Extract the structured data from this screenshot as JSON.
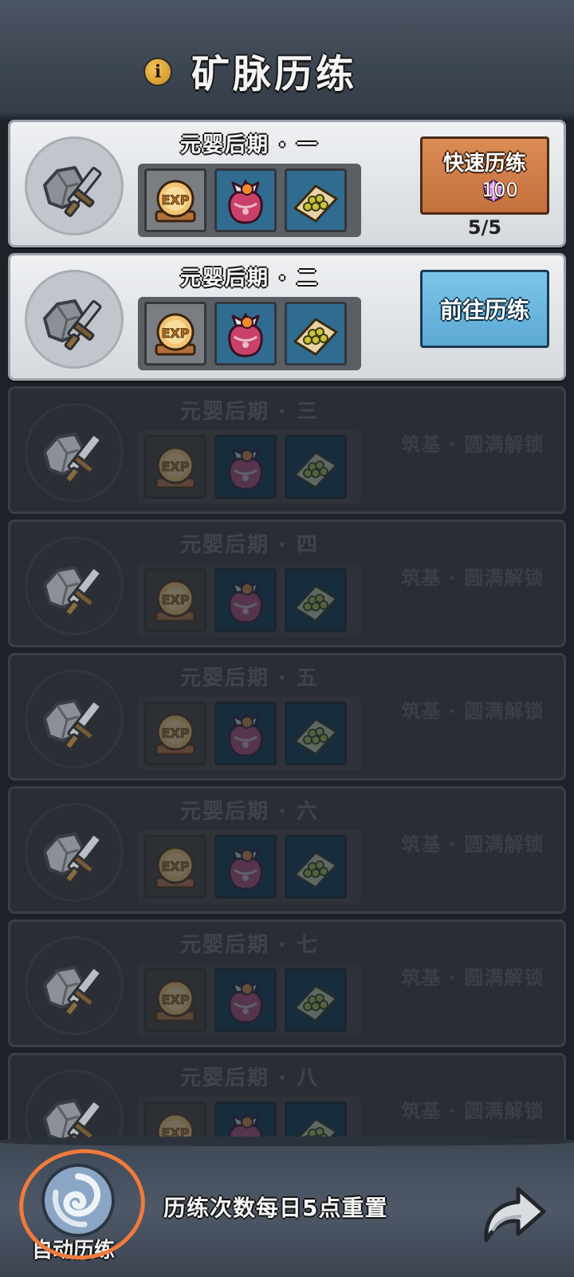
{
  "header": {
    "title": "矿脉历练",
    "info_icon": "info-icon"
  },
  "rows": [
    {
      "title": "元婴后期 · 一",
      "state": "quick",
      "button_label": "快速历练",
      "cost": "100",
      "count": "5/5"
    },
    {
      "title": "元婴后期 · 二",
      "state": "go",
      "button_label": "前往历练"
    },
    {
      "title": "元婴后期 · 三",
      "state": "locked",
      "lock_text": "筑基 · 圆满解锁"
    },
    {
      "title": "元婴后期 · 四",
      "state": "locked",
      "lock_text": "筑基 · 圆满解锁"
    },
    {
      "title": "元婴后期 · 五",
      "state": "locked",
      "lock_text": "筑基 · 圆满解锁"
    },
    {
      "title": "元婴后期 · 六",
      "state": "locked",
      "lock_text": "筑基 · 圆满解锁"
    },
    {
      "title": "元婴后期 · 七",
      "state": "locked",
      "lock_text": "筑基 · 圆满解锁"
    },
    {
      "title": "元婴后期 · 八",
      "state": "locked",
      "lock_text": "筑基 · 圆满解锁"
    }
  ],
  "reward_icons": [
    "exp-scroll-icon",
    "treasure-bag-icon",
    "pill-tray-icon"
  ],
  "footer": {
    "auto_label": "自动历练",
    "reset_text": "历练次数每日5点重置",
    "share_icon": "share-arrow-icon",
    "auto_icon": "swirl-icon"
  },
  "colors": {
    "quick_button": "#c4703d",
    "go_button": "#5ca9d4",
    "annotation_circle": "#f07a3c"
  }
}
